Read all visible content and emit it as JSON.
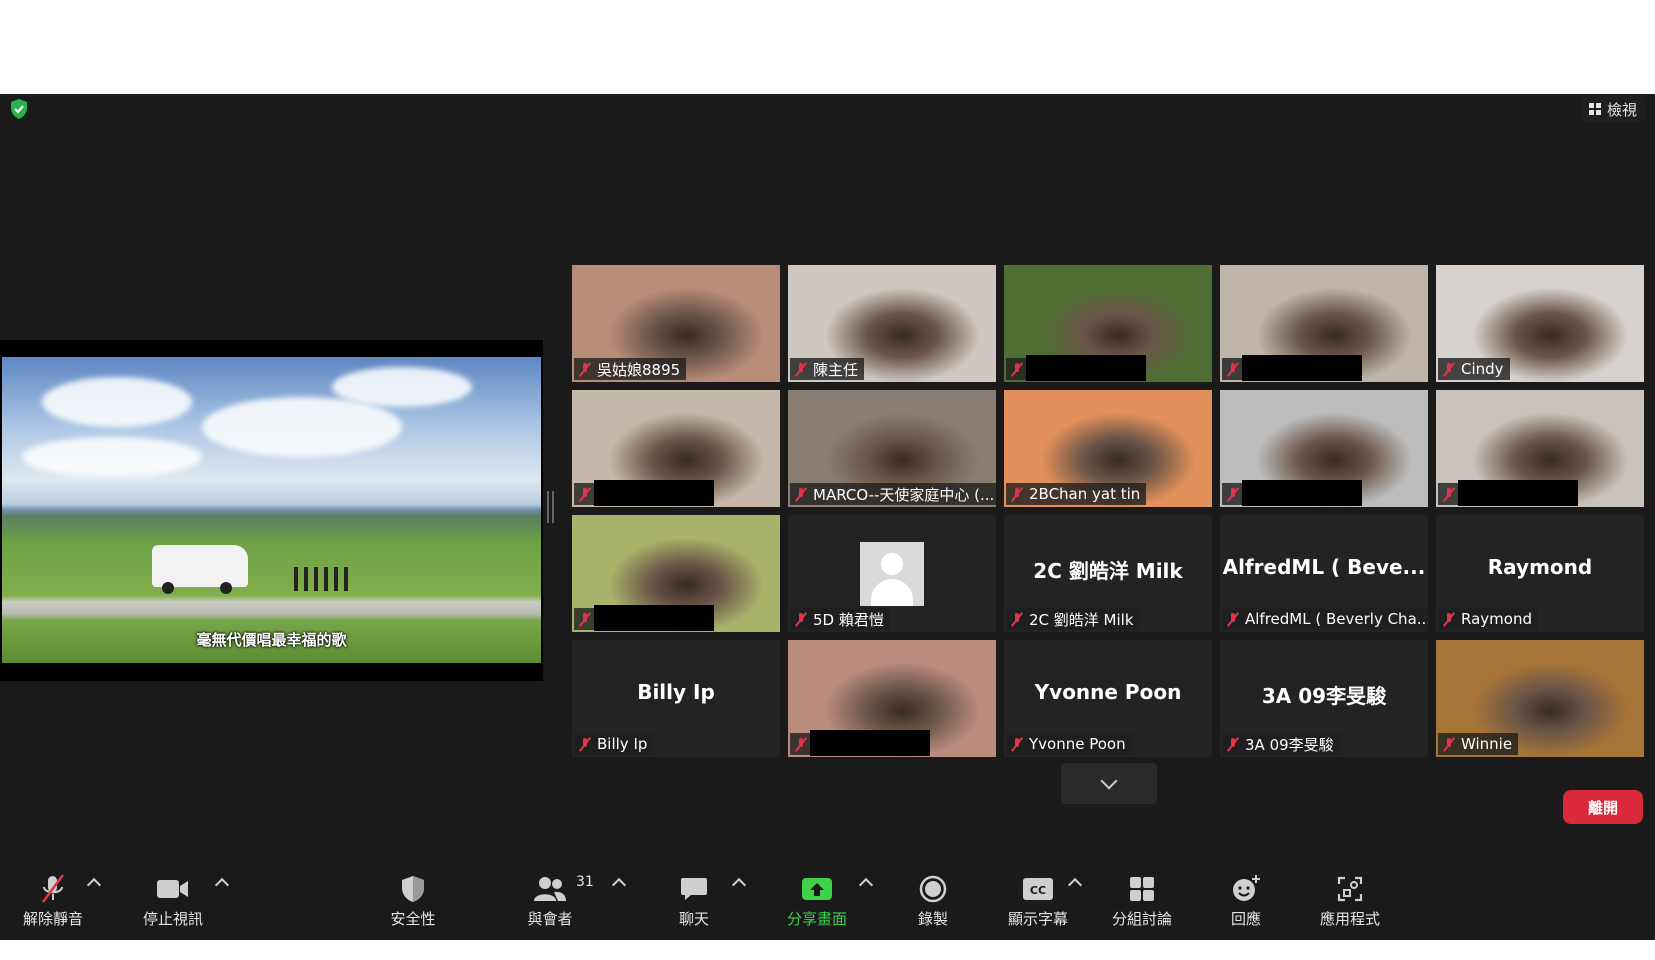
{
  "header": {
    "view_label": "檢視"
  },
  "share": {
    "subtitle": "毫無代價唱最幸福的歌"
  },
  "participants": [
    {
      "name": "吳姑娘8895",
      "video": true,
      "bg": "#b88d7a"
    },
    {
      "name": "陳主任",
      "video": true,
      "bg": "#cfc8c2"
    },
    {
      "name": "",
      "video": true,
      "bg": "#4f6e34",
      "redacted": true
    },
    {
      "name": "",
      "video": true,
      "bg": "#bfb5aa",
      "redacted": true
    },
    {
      "name": "Cindy",
      "video": true,
      "bg": "#d7d2cd"
    },
    {
      "name": "",
      "video": true,
      "bg": "#c6b8a8",
      "redacted": true
    },
    {
      "name": "MARCO--天使家庭中心 (...",
      "video": true,
      "bg": "#8b7f74",
      "active": true
    },
    {
      "name": "2BChan yat tin",
      "video": true,
      "bg": "#e3915a"
    },
    {
      "name": "",
      "video": true,
      "bg": "#bdbdbd",
      "redacted": true
    },
    {
      "name": "",
      "video": true,
      "bg": "#c8c2bb",
      "redacted": true
    },
    {
      "name": "",
      "video": true,
      "bg": "#a9b26a",
      "redacted": true
    },
    {
      "name": "5D 賴君愷",
      "video": false,
      "avatar": true
    },
    {
      "name": "2C 劉皓洋 Milk",
      "video": false,
      "big": "2C 劉皓洋 Milk"
    },
    {
      "name": "AlfredML ( Beverly Cha...",
      "video": false,
      "big": "AlfredML ( Beve..."
    },
    {
      "name": "Raymond",
      "video": false,
      "big": "Raymond"
    },
    {
      "name": "Billy Ip",
      "video": false,
      "big": "Billy Ip"
    },
    {
      "name": "",
      "video": true,
      "bg": "#b98c7e",
      "redacted": true
    },
    {
      "name": "Yvonne Poon",
      "video": false,
      "big": "Yvonne Poon"
    },
    {
      "name": "3A 09李旻駿",
      "video": false,
      "big": "3A 09李旻駿"
    },
    {
      "name": "Winnie",
      "video": true,
      "bg": "#a87538"
    }
  ],
  "toolbar": {
    "unmute": "解除靜音",
    "stop_video": "停止視訊",
    "security": "安全性",
    "participants": "與會者",
    "participant_count": "31",
    "chat": "聊天",
    "share_screen": "分享畫面",
    "record": "錄製",
    "captions": "顯示字幕",
    "breakout": "分組討論",
    "reactions": "回應",
    "apps": "應用程式",
    "leave": "離開",
    "accent_green": "#3fd14a",
    "leave_red": "#d9293a"
  }
}
